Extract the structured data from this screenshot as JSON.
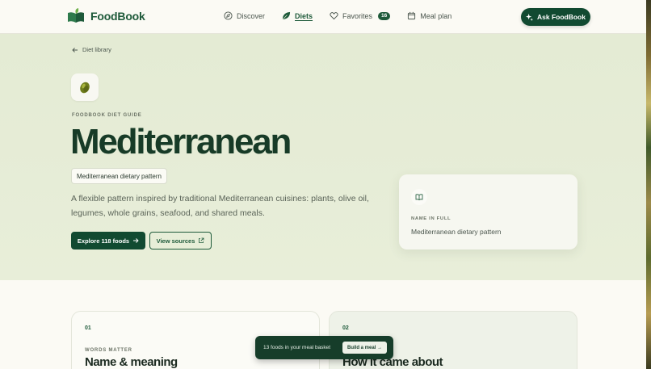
{
  "app": {
    "name": "FoodBook"
  },
  "nav": {
    "items": [
      {
        "label": "Discover",
        "icon": "compass-icon"
      },
      {
        "label": "Diets",
        "icon": "leaf-icon",
        "active": true
      },
      {
        "label": "Favorites",
        "icon": "heart-icon",
        "badge": "16"
      },
      {
        "label": "Meal plan",
        "icon": "calendar-icon"
      }
    ],
    "ask_label": "Ask FoodBook"
  },
  "hero": {
    "back_label": "Diet library",
    "eyebrow": "FOODBOOK DIET GUIDE",
    "title": "Mediterranean",
    "pill": "Mediterranean dietary pattern",
    "description": "A flexible pattern inspired by traditional Mediterranean cuisines: plants, olive oil, legumes, whole grains, seafood, and shared meals.",
    "primary_cta": "Explore 118 foods",
    "secondary_cta": "View sources",
    "info_card": {
      "label": "NAME IN FULL",
      "value": "Mediterranean dietary pattern"
    }
  },
  "sections": [
    {
      "number": "01",
      "kicker": "WORDS MATTER",
      "heading": "Name & meaning"
    },
    {
      "number": "02",
      "kicker": "",
      "heading": "How it came about"
    }
  ],
  "basket": {
    "text": "13 foods in your meal basket",
    "button": "Build a meal →"
  },
  "colors": {
    "brand": "#114a31",
    "hero_bg": "#e4ebd4",
    "page_bg": "#fbfaf4"
  }
}
